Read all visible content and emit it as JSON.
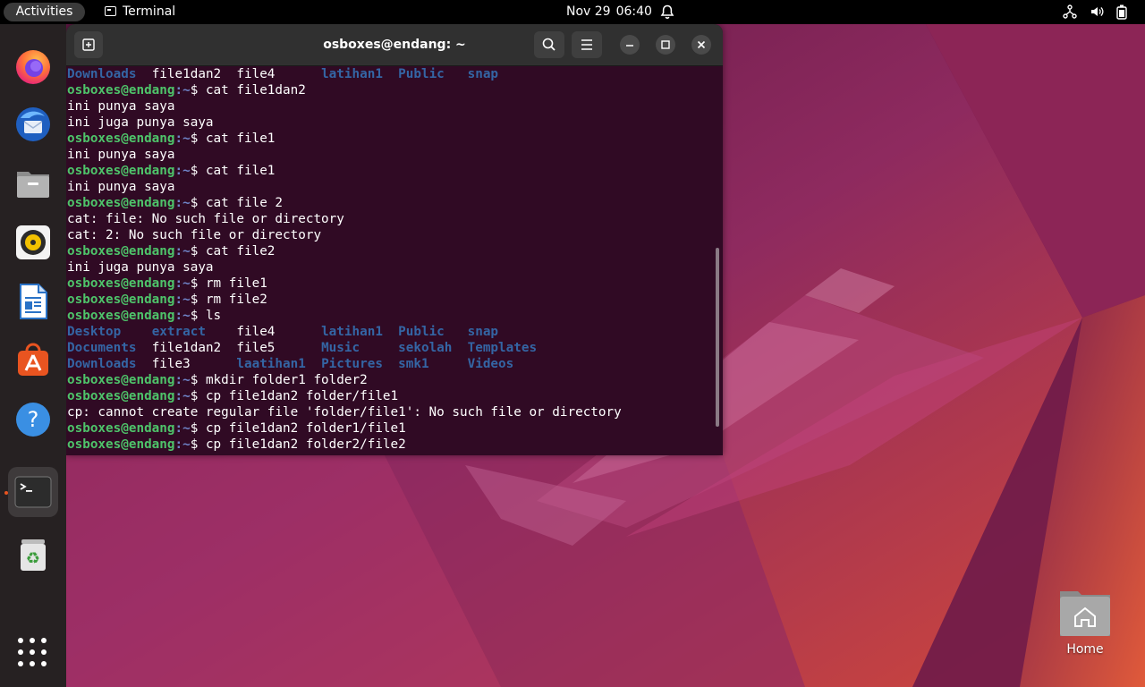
{
  "topbar": {
    "activities_label": "Activities",
    "app_name": "Terminal",
    "date": "Nov 29",
    "time": "06:40"
  },
  "dock": {
    "apps": [
      "firefox-icon",
      "thunderbird-icon",
      "files-icon",
      "rhythmbox-icon",
      "libreoffice-writer-icon",
      "app-center-icon",
      "help-icon",
      "terminal-icon",
      "trash-icon"
    ],
    "active_app": "terminal-icon"
  },
  "terminal": {
    "title": "osboxes@endang: ~",
    "prompt_user": "osboxes@endang",
    "prompt_path": ":~",
    "prompt_symbol": "$",
    "lines": [
      {
        "type": "ls",
        "cols": [
          "Downloads",
          "file1dan2",
          "file4",
          "latihan1",
          "Public",
          "snap"
        ]
      },
      {
        "type": "cmd",
        "text": " cat file1dan2"
      },
      {
        "type": "out",
        "text": "ini punya saya"
      },
      {
        "type": "out",
        "text": "ini juga punya saya"
      },
      {
        "type": "cmd",
        "text": " cat file1"
      },
      {
        "type": "out",
        "text": "ini punya saya"
      },
      {
        "type": "cmd",
        "text": " cat file1"
      },
      {
        "type": "out",
        "text": "ini punya saya"
      },
      {
        "type": "cmd",
        "text": " cat file 2"
      },
      {
        "type": "out",
        "text": "cat: file: No such file or directory"
      },
      {
        "type": "out",
        "text": "cat: 2: No such file or directory"
      },
      {
        "type": "cmd",
        "text": " cat file2"
      },
      {
        "type": "out",
        "text": "ini juga punya saya"
      },
      {
        "type": "cmd",
        "text": " rm file1"
      },
      {
        "type": "cmd",
        "text": " rm file2"
      },
      {
        "type": "cmd",
        "text": " ls"
      },
      {
        "type": "ls",
        "cols": [
          "Desktop",
          "extract",
          "file4",
          "latihan1",
          "Public",
          "snap"
        ]
      },
      {
        "type": "ls",
        "cols": [
          "Documents",
          "file1dan2",
          "file5",
          "Music",
          "sekolah",
          "Templates"
        ]
      },
      {
        "type": "ls",
        "cols": [
          "Downloads",
          "file3",
          "laatihan1",
          "Pictures",
          "smk1",
          "Videos"
        ]
      },
      {
        "type": "cmd",
        "text": " mkdir folder1 folder2"
      },
      {
        "type": "cmd",
        "text": " cp file1dan2 folder/file1"
      },
      {
        "type": "out",
        "text": "cp: cannot create regular file 'folder/file1': No such file or directory"
      },
      {
        "type": "cmd",
        "text": " cp file1dan2 folder1/file1"
      },
      {
        "type": "cmd",
        "text": " cp file1dan2 folder2/file2"
      }
    ]
  },
  "desktop": {
    "home_label": "Home"
  },
  "colors": {
    "terminal_bg": "#300a24",
    "prompt_user": "#4ec46a",
    "prompt_path": "#6f84c8",
    "directory": "#3465a4",
    "accent": "#e95420"
  }
}
